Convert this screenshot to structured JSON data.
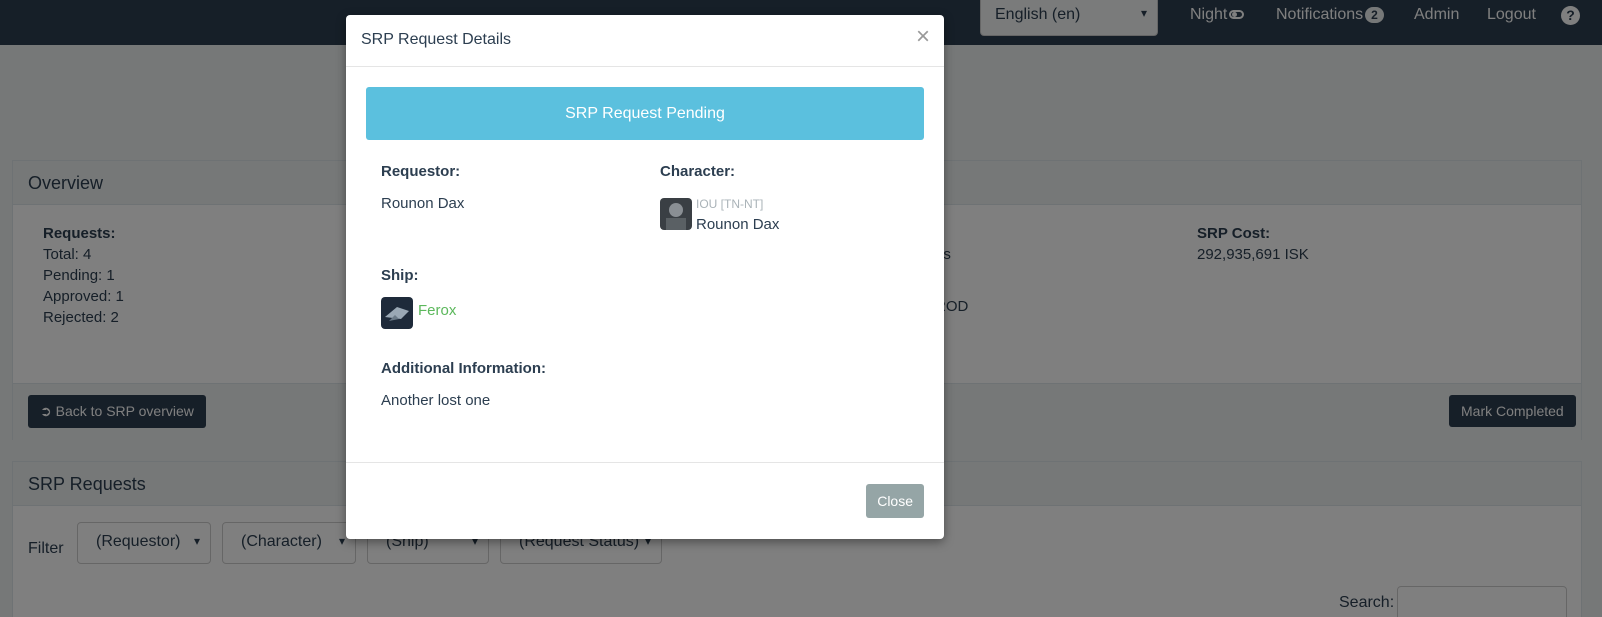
{
  "navbar": {
    "language": "English (en)",
    "night_label": "Night",
    "notifications_label": "Notifications",
    "notifications_count": "2",
    "admin_label": "Admin",
    "logout_label": "Logout",
    "help_icon": "?"
  },
  "overview": {
    "heading": "Overview",
    "requests_label": "Requests:",
    "total": "Total: 4",
    "pending": "Pending: 1",
    "approved": "Approved: 1",
    "rejected": "Rejected: 2",
    "partial_text_1": "os",
    "partial_text_2": "ROD",
    "srp_cost_label": "SRP Cost:",
    "srp_cost_value": "292,935,691 ISK",
    "back_button": "Back to SRP overview",
    "mark_completed_button": "Mark Completed"
  },
  "srp_requests": {
    "heading": "SRP Requests",
    "filter_label": "Filter",
    "filters": [
      "(Requestor)",
      "(Character)",
      "(Ship)",
      "(Request Status)"
    ],
    "search_label": "Search:"
  },
  "modal": {
    "title": "SRP Request Details",
    "close_x": "×",
    "status_banner": "SRP Request Pending",
    "requestor_label": "Requestor:",
    "requestor_value": "Rounon Dax",
    "character_label": "Character:",
    "character_corp": "IOU [TN-NT]",
    "character_name": "Rounon Dax",
    "ship_label": "Ship:",
    "ship_name": "Ferox",
    "additional_info_label": "Additional Information:",
    "additional_info_value": "Another lost one",
    "close_button": "Close"
  },
  "colors": {
    "navbar": "#2c3e50",
    "info_banner": "#5bc0de",
    "ship_link": "#5cb85c",
    "close_button": "#95a5a6"
  }
}
